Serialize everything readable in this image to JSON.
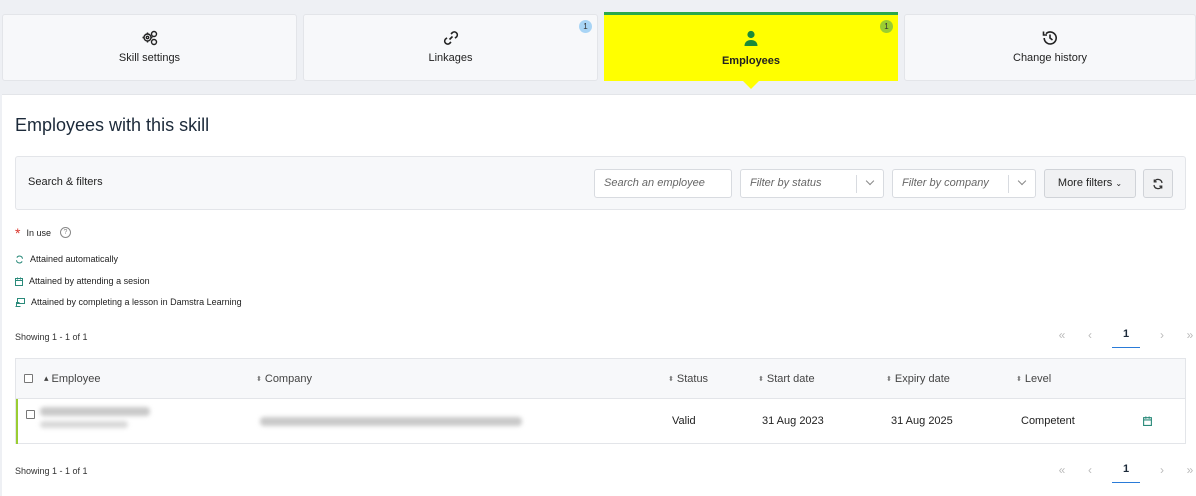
{
  "tabs": [
    {
      "label": "Skill settings",
      "icon": "gears-icon",
      "badge": ""
    },
    {
      "label": "Linkages",
      "icon": "link-icon",
      "badge": "1"
    },
    {
      "label": "Employees",
      "icon": "person-icon",
      "badge": "1"
    },
    {
      "label": "Change history",
      "icon": "history-icon",
      "badge": ""
    }
  ],
  "colors": {
    "active_tab": "#ffff00",
    "active_border": "#2aa84a",
    "linkages_badge": "#a8d4f5",
    "employees_badge": "#9acd32",
    "row_accent": "#9acd32",
    "required_star": "#d9342b",
    "calendar_icon": "#2a8a7a"
  },
  "page_title": "Employees with this skill",
  "filters": {
    "label": "Search & filters",
    "search_placeholder": "Search an employee",
    "status_placeholder": "Filter by status",
    "company_placeholder": "Filter by company",
    "more_filters": "More filters",
    "refresh_icon": "refresh-icon"
  },
  "legend": {
    "in_use": "In use",
    "auto": "Attained automatically",
    "session": "Attained by attending a sesion",
    "lesson": "Attained by completing a lesson in Damstra Learning"
  },
  "showing_top": "Showing 1 - 1 of 1",
  "showing_bottom": "Showing 1 - 1 of 1",
  "pagination": {
    "first": "«",
    "prev": "‹",
    "current": "1",
    "next": "›",
    "last": "»"
  },
  "table": {
    "columns": [
      "Employee",
      "Company",
      "Status",
      "Start date",
      "Expiry date",
      "Level"
    ],
    "rows": [
      {
        "status": "Valid",
        "start": "31 Aug 2023",
        "expiry": "31 Aug 2025",
        "level": "Competent",
        "icon": "calendar-icon"
      }
    ]
  }
}
